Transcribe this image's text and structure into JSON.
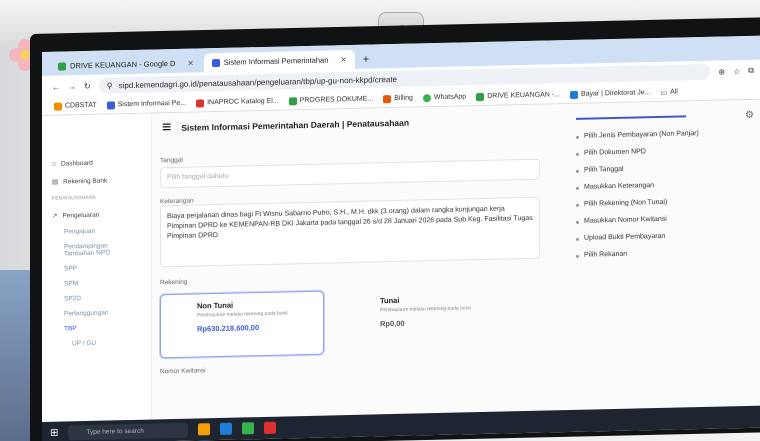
{
  "tabs": [
    {
      "label": "DRIVE KEUANGAN - Google D"
    },
    {
      "label": "Sistem Informasi Pemerintahan"
    }
  ],
  "address": "sipd.kemendagri.go.id/penatausahaan/pengeluaran/tbp/up-gu-non-kkpd/create",
  "bookmarks": [
    "CDBSTAT",
    "Sistem Informasi Pe...",
    "INAPROC Katalog El...",
    "PROGRES DOKUME...",
    "Billing",
    "WhatsApp",
    "DRIVE KEUANGAN -...",
    "Bayar | Direktorat Je...",
    "All"
  ],
  "app": {
    "title": "Sistem Informasi Pemerintahan Daerah | Penatausahaan",
    "sidebar": [
      {
        "label": "Dashboard"
      },
      {
        "label": "Rekening Bank"
      },
      {
        "label": "PENATAUSAHAAN"
      },
      {
        "label": "Pengeluaran"
      },
      {
        "label": "Pengajuan"
      },
      {
        "label": "Pendampingan Tambahan NPD"
      },
      {
        "label": "SPP"
      },
      {
        "label": "SPM"
      },
      {
        "label": "SP2D"
      },
      {
        "label": "Pertanggungan"
      },
      {
        "label": "TBP"
      },
      {
        "label": "UP / GU"
      }
    ],
    "form": {
      "tanggal_label": "Tanggal",
      "tanggal_placeholder": "Pilih tanggal dahulu",
      "keterangan_label": "Keterangan",
      "keterangan_value": "Biaya perjalanan dinas bagi Ft Wisnu Sabarno Putro, S.H., M.H. dkk (3 orang) dalam rangka kunjungan kerja Pimpinan DPRD ke KEMENPAN-RB DKI Jakarta pada tanggal 26 s/d 28 Januari 2026 pada Sub Keg. Fasilitasi Tugas Pimpinan DPRD",
      "rekening_label": "Rekening",
      "nomor_kwitansi_label": "Nomor Kwitansi",
      "cards": [
        {
          "title": "Non Tunai",
          "desc": "Pembayaran melalui rekening pada bank",
          "amount": "Rp630.218.600,00",
          "selected": true
        },
        {
          "title": "Tunai",
          "desc": "Pembayaran melalui rekening pada tunai",
          "amount": "Rp0,00",
          "selected": false
        }
      ]
    },
    "steps": [
      "Pilih Jenis Pembayaran (Non Panjar)",
      "Pilih Dokumen NPD",
      "Pilih Tanggal",
      "Masukkan Keterangan",
      "Pilih Rekening (Non Tunai)",
      "Masukkan Nomor Kwitansi",
      "Upload Bukti Pembayaran",
      "Pilih Rekanan"
    ]
  },
  "taskbar": {
    "search_placeholder": "Type here to search"
  },
  "colors": {
    "accent": "#4257c9",
    "tabbar": "#cfe0f5"
  }
}
